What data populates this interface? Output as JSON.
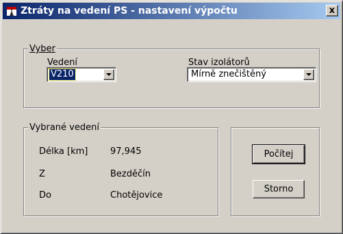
{
  "window": {
    "title": "Ztráty na vedení PS - nastavení výpočtu",
    "close_label": "x"
  },
  "vyber": {
    "legend": "Vyber",
    "vedeni_label": "Vedení",
    "vedeni_value": "V210",
    "stav_label": "Stav izolátorů",
    "stav_value": "Mírně znečištěný"
  },
  "vybrane": {
    "legend": "Vybrané vedení",
    "rows": [
      {
        "label": "Délka [km]",
        "value": "97,945"
      },
      {
        "label": "Z",
        "value": "Bezděčín"
      },
      {
        "label": "Do",
        "value": "Chotějovice"
      }
    ]
  },
  "buttons": {
    "compute_label": "Počítej",
    "cancel_label": "Storno"
  }
}
